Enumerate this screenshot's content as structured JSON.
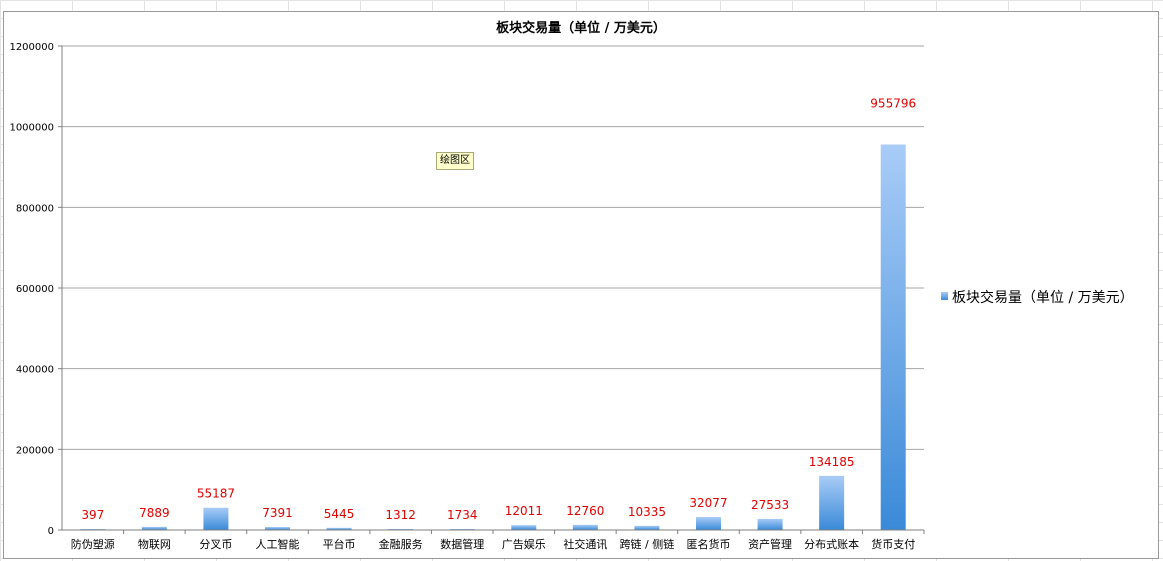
{
  "tooltip": "绘图区",
  "colors": {
    "bar_top": "#a9ccf7",
    "bar_bottom": "#3a8ad8",
    "label": "#e00000",
    "grid": "#a6a6a6"
  },
  "chart_data": {
    "type": "bar",
    "title": "板块交易量（单位 / 万美元）",
    "categories": [
      "防伪塑源",
      "物联网",
      "分叉币",
      "人工智能",
      "平台币",
      "金融服务",
      "数据管理",
      "广告娱乐",
      "社交通讯",
      "跨链 / 侧链",
      "匿名货币",
      "资产管理",
      "分布式账本",
      "货币支付"
    ],
    "series": [
      {
        "name": "板块交易量（单位 / 万美元）",
        "values": [
          397,
          7889,
          55187,
          7391,
          5445,
          1312,
          1734,
          12011,
          12760,
          10335,
          32077,
          27533,
          134185,
          955796
        ]
      }
    ],
    "y_ticks": [
      "0",
      "200000",
      "400000",
      "600000",
      "800000",
      "1000000",
      "1200000"
    ],
    "ylim": [
      0,
      1200000
    ],
    "grid": true,
    "legend_position": "right",
    "data_labels": true
  }
}
